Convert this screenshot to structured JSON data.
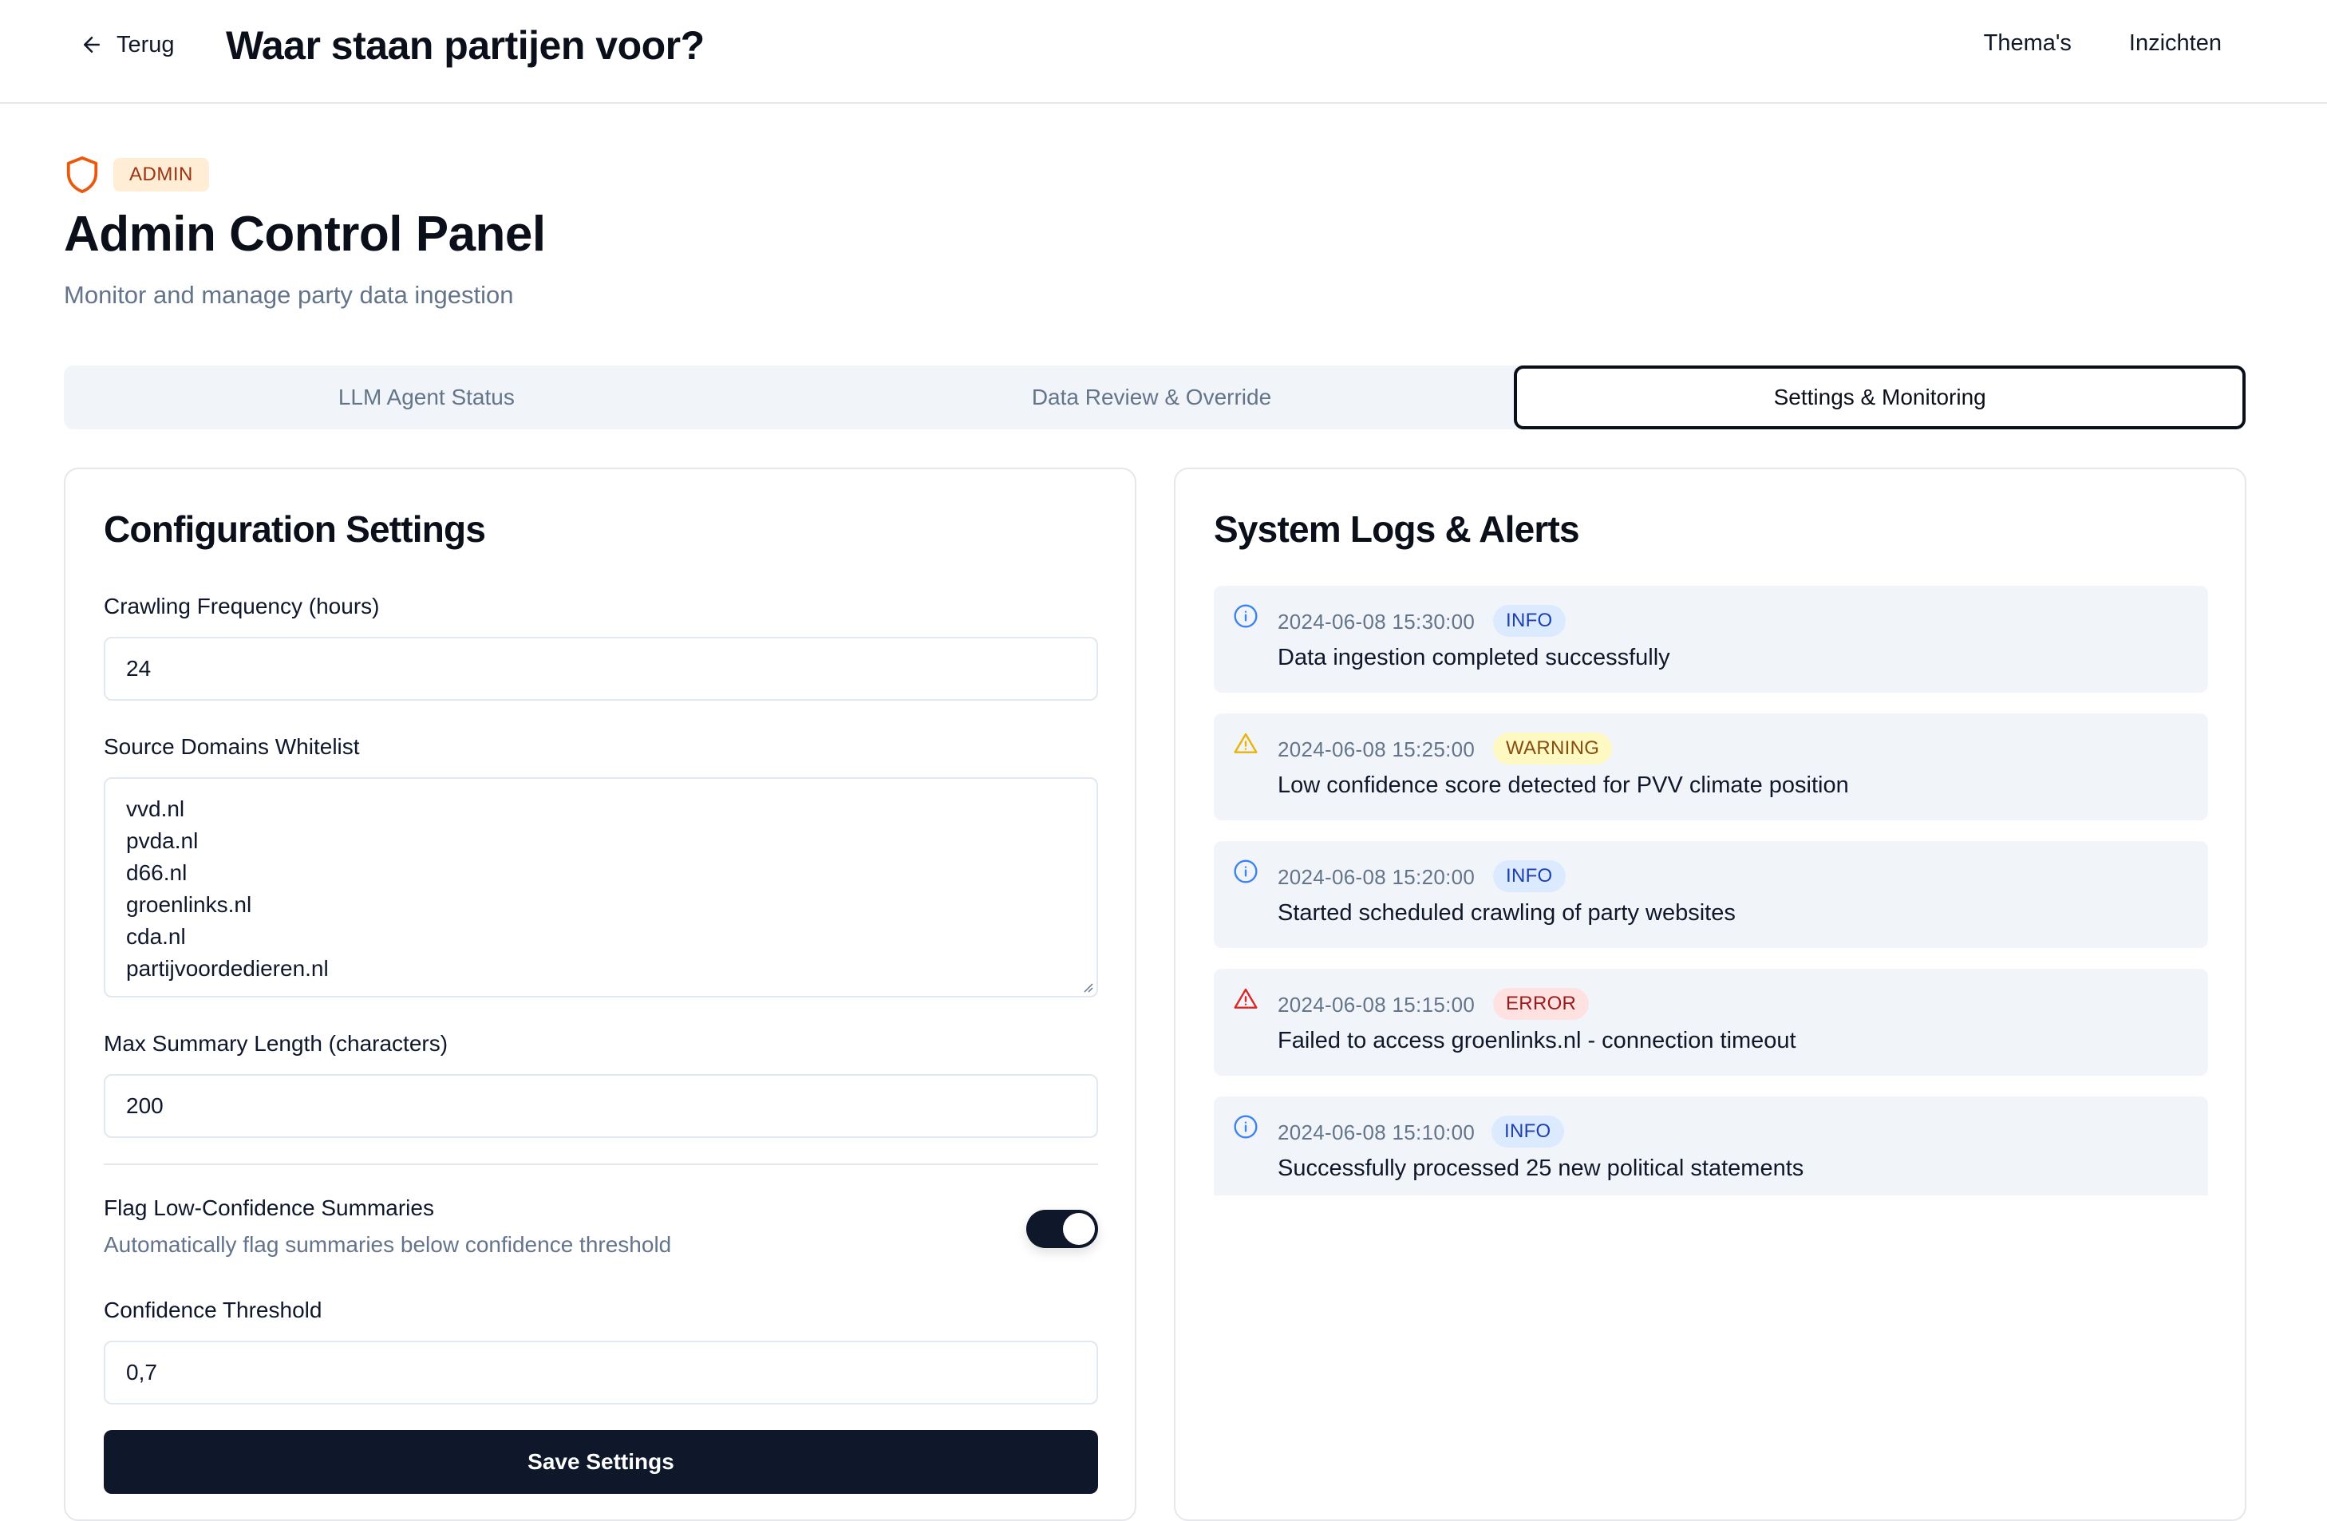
{
  "header": {
    "back_label": "Terug",
    "app_title": "Waar staan partijen voor?",
    "nav": [
      "Thema's",
      "Inzichten"
    ]
  },
  "admin": {
    "badge": "ADMIN",
    "title": "Admin Control Panel",
    "subtitle": "Monitor and manage party data ingestion"
  },
  "tabs": [
    {
      "label": "LLM Agent Status",
      "active": false
    },
    {
      "label": "Data Review & Override",
      "active": false
    },
    {
      "label": "Settings & Monitoring",
      "active": true
    }
  ],
  "config": {
    "title": "Configuration Settings",
    "crawl_label": "Crawling Frequency (hours)",
    "crawl_value": "24",
    "whitelist_label": "Source Domains Whitelist",
    "whitelist_value": "vvd.nl\npvda.nl\nd66.nl\ngroenlinks.nl\ncda.nl\npartijvoordedieren.nl",
    "max_len_label": "Max Summary Length (characters)",
    "max_len_value": "200",
    "flag_title": "Flag Low-Confidence Summaries",
    "flag_sub": "Automatically flag summaries below confidence threshold",
    "flag_on": true,
    "threshold_label": "Confidence Threshold",
    "threshold_value": "0,7",
    "save_label": "Save Settings"
  },
  "logs": {
    "title": "System Logs & Alerts",
    "items": [
      {
        "time": "2024-06-08 15:30:00",
        "level": "INFO",
        "icon": "info-icon",
        "message": "Data ingestion completed successfully"
      },
      {
        "time": "2024-06-08 15:25:00",
        "level": "WARNING",
        "icon": "warning-icon",
        "message": "Low confidence score detected for PVV climate position"
      },
      {
        "time": "2024-06-08 15:20:00",
        "level": "INFO",
        "icon": "info-icon",
        "message": "Started scheduled crawling of party websites"
      },
      {
        "time": "2024-06-08 15:15:00",
        "level": "ERROR",
        "icon": "error-icon",
        "message": "Failed to access groenlinks.nl - connection timeout"
      },
      {
        "time": "2024-06-08 15:10:00",
        "level": "INFO",
        "icon": "info-icon",
        "message": "Successfully processed 25 new political statements"
      }
    ]
  },
  "colors": {
    "accent": "#0f172a",
    "admin_orange": "#ea580c",
    "info_blue": "#3b82f6",
    "warn_amber": "#eab308",
    "error_red": "#dc2626"
  }
}
